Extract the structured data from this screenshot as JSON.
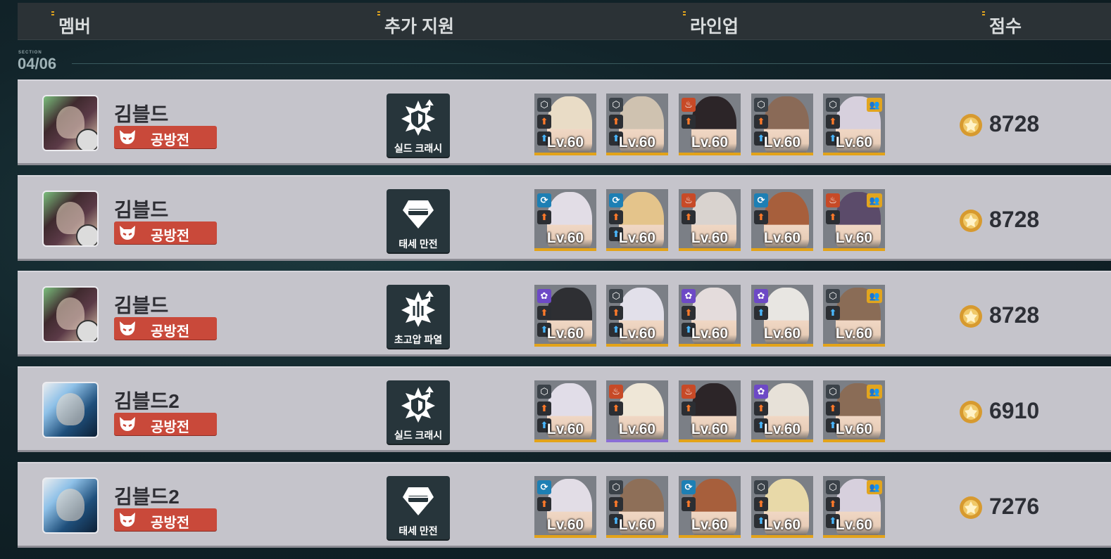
{
  "header": {
    "columns": [
      {
        "label": "멤버"
      },
      {
        "label": "추가 지원"
      },
      {
        "label": "라인업"
      },
      {
        "label": "점수"
      }
    ]
  },
  "section": {
    "label": "SECTION",
    "number": "04/06"
  },
  "rows": [
    {
      "member": "김블드",
      "mode": "공방전",
      "support": "실드 크래시",
      "score": "8728",
      "units": [
        {
          "level": "Lv.60"
        },
        {
          "level": "Lv.60"
        },
        {
          "level": "Lv.60"
        },
        {
          "level": "Lv.60"
        },
        {
          "level": "Lv.60"
        }
      ]
    },
    {
      "member": "김블드",
      "mode": "공방전",
      "support": "태세 만전",
      "score": "8728",
      "units": [
        {
          "level": "Lv.60"
        },
        {
          "level": "Lv.60"
        },
        {
          "level": "Lv.60"
        },
        {
          "level": "Lv.60"
        },
        {
          "level": "Lv.60"
        }
      ]
    },
    {
      "member": "김블드",
      "mode": "공방전",
      "support": "초고압 파열",
      "score": "8728",
      "units": [
        {
          "level": "Lv.60"
        },
        {
          "level": "Lv.60"
        },
        {
          "level": "Lv.60"
        },
        {
          "level": "Lv.60"
        },
        {
          "level": "Lv.60"
        }
      ]
    },
    {
      "member": "김블드2",
      "mode": "공방전",
      "support": "실드 크래시",
      "score": "6910",
      "units": [
        {
          "level": "Lv.60"
        },
        {
          "level": "Lv.60"
        },
        {
          "level": "Lv.60"
        },
        {
          "level": "Lv.60"
        },
        {
          "level": "Lv.60"
        }
      ]
    },
    {
      "member": "김블드2",
      "mode": "공방전",
      "support": "태세 만전",
      "score": "7276",
      "units": [
        {
          "level": "Lv.60"
        },
        {
          "level": "Lv.60"
        },
        {
          "level": "Lv.60"
        },
        {
          "level": "Lv.60"
        },
        {
          "level": "Lv.60"
        }
      ]
    }
  ],
  "colors": {
    "badge": "#c9493a",
    "accent": "#e2a51e",
    "support_tile": "#27353b",
    "row_bg": "#c5c4cb"
  }
}
